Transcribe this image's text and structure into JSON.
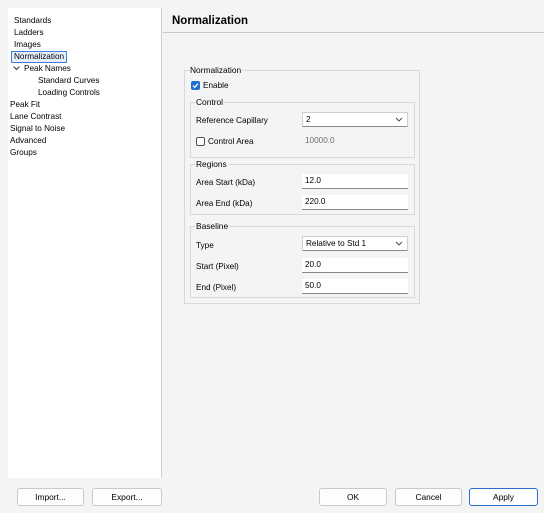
{
  "nav": {
    "items": [
      {
        "label": "Standards"
      },
      {
        "label": "Ladders"
      },
      {
        "label": "Images"
      },
      {
        "label": "Normalization",
        "selected": true
      },
      {
        "label": "Peak Names",
        "expanded": true
      },
      {
        "label": "Standard Curves"
      },
      {
        "label": "Loading Controls"
      },
      {
        "label": "Peak Fit"
      },
      {
        "label": "Lane Contrast"
      },
      {
        "label": "Signal to Noise"
      },
      {
        "label": "Advanced"
      },
      {
        "label": "Groups"
      }
    ]
  },
  "panel": {
    "title": "Normalization",
    "group_label": "Normalization",
    "enable": {
      "label": "Enable",
      "checked": true
    },
    "control": {
      "label": "Control",
      "reference_capillary_label": "Reference Capillary",
      "reference_capillary_value": "2",
      "control_area_label": "Control Area",
      "control_area_checked": false,
      "control_area_value": "10000.0"
    },
    "regions": {
      "label": "Regions",
      "area_start_label": "Area Start (kDa)",
      "area_start_value": "12.0",
      "area_end_label": "Area End (kDa)",
      "area_end_value": "220.0"
    },
    "baseline": {
      "label": "Baseline",
      "type_label": "Type",
      "type_value": "Relative to Std 1",
      "start_label": "Start (Pixel)",
      "start_value": "20.0",
      "end_label": "End (Pixel)",
      "end_value": "50.0"
    }
  },
  "footer": {
    "import_label": "Import...",
    "export_label": "Export...",
    "ok_label": "OK",
    "cancel_label": "Cancel",
    "apply_label": "Apply"
  },
  "colors": {
    "accent": "#1f6fd1",
    "selection_border": "#3c7fd8"
  }
}
